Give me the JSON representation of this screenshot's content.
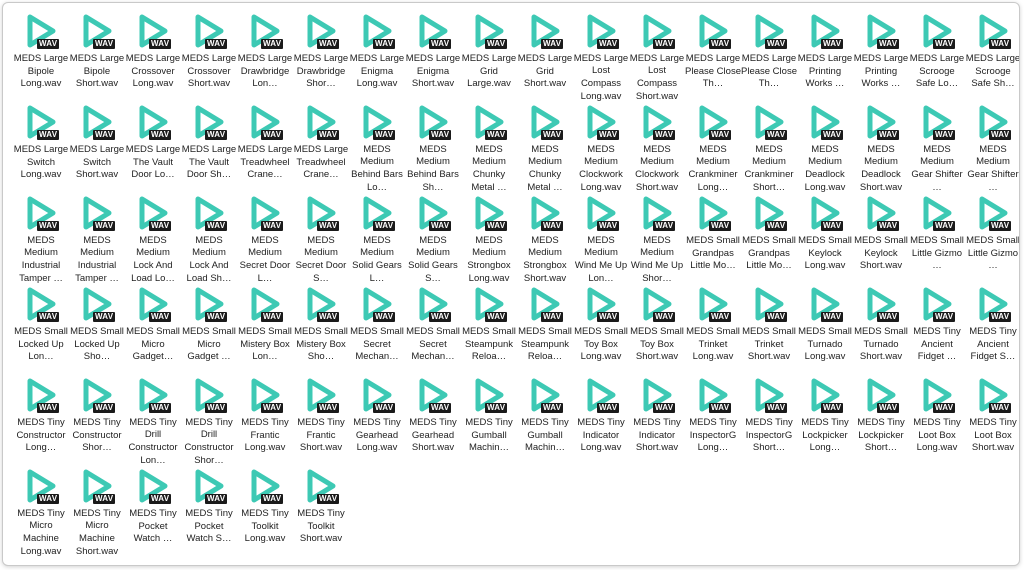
{
  "icon": {
    "name": "wav-audio-file-icon",
    "badge": "WAV",
    "accent": "#3dc9b4"
  },
  "files": [
    {
      "name": "MEDS Large Bipole Long.wav"
    },
    {
      "name": "MEDS Large Bipole Short.wav"
    },
    {
      "name": "MEDS Large Crossover Long.wav"
    },
    {
      "name": "MEDS Large Crossover Short.wav"
    },
    {
      "name": "MEDS Large Drawbridge Lon…"
    },
    {
      "name": "MEDS Large Drawbridge Shor…"
    },
    {
      "name": "MEDS Large Enigma Long.wav"
    },
    {
      "name": "MEDS Large Enigma Short.wav"
    },
    {
      "name": "MEDS Large Grid Large.wav"
    },
    {
      "name": "MEDS Large Grid Short.wav"
    },
    {
      "name": "MEDS Large Lost Compass Long.wav"
    },
    {
      "name": "MEDS Large Lost Compass Short.wav"
    },
    {
      "name": "MEDS Large Please Close Th…"
    },
    {
      "name": "MEDS Large Please Close Th…"
    },
    {
      "name": "MEDS Large Printing Works …"
    },
    {
      "name": "MEDS Large Printing Works …"
    },
    {
      "name": "MEDS Large Scrooge Safe Lo…"
    },
    {
      "name": "MEDS Large Scrooge Safe Sh…"
    },
    {
      "name": "MEDS Large Switch Long.wav"
    },
    {
      "name": "MEDS Large Switch Short.wav"
    },
    {
      "name": "MEDS Large The Vault Door Lo…"
    },
    {
      "name": "MEDS Large The Vault Door Sh…"
    },
    {
      "name": "MEDS Large Treadwheel Crane…"
    },
    {
      "name": "MEDS Large Treadwheel Crane…"
    },
    {
      "name": "MEDS Medium Behind Bars Lo…"
    },
    {
      "name": "MEDS Medium Behind Bars Sh…"
    },
    {
      "name": "MEDS Medium Chunky Metal …"
    },
    {
      "name": "MEDS Medium Chunky Metal …"
    },
    {
      "name": "MEDS Medium Clockwork Long.wav"
    },
    {
      "name": "MEDS Medium Clockwork Short.wav"
    },
    {
      "name": "MEDS Medium Crankminer Long…"
    },
    {
      "name": "MEDS Medium Crankminer Short…"
    },
    {
      "name": "MEDS Medium Deadlock Long.wav"
    },
    {
      "name": "MEDS Medium Deadlock Short.wav"
    },
    {
      "name": "MEDS Medium Gear Shifter …"
    },
    {
      "name": "MEDS Medium Gear Shifter …"
    },
    {
      "name": "MEDS Medium Industrial Tamper …"
    },
    {
      "name": "MEDS Medium Industrial Tamper …"
    },
    {
      "name": "MEDS Medium Lock And Load Lo…"
    },
    {
      "name": "MEDS Medium Lock And Load Sh…"
    },
    {
      "name": "MEDS Medium Secret Door L…"
    },
    {
      "name": "MEDS Medium Secret Door S…"
    },
    {
      "name": "MEDS Medium Solid Gears L…"
    },
    {
      "name": "MEDS Medium Solid Gears S…"
    },
    {
      "name": "MEDS Medium Strongbox Long.wav"
    },
    {
      "name": "MEDS Medium Strongbox Short.wav"
    },
    {
      "name": "MEDS Medium Wind Me Up Lon…"
    },
    {
      "name": "MEDS Medium Wind Me Up Shor…"
    },
    {
      "name": "MEDS Small Grandpas Little Mo…"
    },
    {
      "name": "MEDS Small Grandpas Little Mo…"
    },
    {
      "name": "MEDS Small Keylock Long.wav"
    },
    {
      "name": "MEDS Small Keylock Short.wav"
    },
    {
      "name": "MEDS Small Little Gizmo …"
    },
    {
      "name": "MEDS Small Little Gizmo …"
    },
    {
      "name": "MEDS Small Locked Up Lon…"
    },
    {
      "name": "MEDS Small Locked Up Sho…"
    },
    {
      "name": "MEDS Small Micro Gadget…"
    },
    {
      "name": "MEDS Small Micro Gadget …"
    },
    {
      "name": "MEDS Small Mistery Box Lon…"
    },
    {
      "name": "MEDS Small Mistery Box Sho…"
    },
    {
      "name": "MEDS Small Secret Mechan…"
    },
    {
      "name": "MEDS Small Secret Mechan…"
    },
    {
      "name": "MEDS Small Steampunk Reloa…"
    },
    {
      "name": "MEDS Small Steampunk Reloa…"
    },
    {
      "name": "MEDS Small Toy Box Long.wav"
    },
    {
      "name": "MEDS Small Toy Box Short.wav"
    },
    {
      "name": "MEDS Small Trinket Long.wav"
    },
    {
      "name": "MEDS Small Trinket Short.wav"
    },
    {
      "name": "MEDS Small Turnado Long.wav"
    },
    {
      "name": "MEDS Small Turnado Short.wav"
    },
    {
      "name": "MEDS Tiny Ancient Fidget …"
    },
    {
      "name": "MEDS Tiny Ancient Fidget S…"
    },
    {
      "name": "MEDS Tiny Constructor Long…"
    },
    {
      "name": "MEDS Tiny Constructor Shor…"
    },
    {
      "name": "MEDS Tiny Drill Constructor Lon…"
    },
    {
      "name": "MEDS Tiny Drill Constructor Shor…"
    },
    {
      "name": "MEDS Tiny Frantic Long.wav"
    },
    {
      "name": "MEDS Tiny Frantic Short.wav"
    },
    {
      "name": "MEDS Tiny Gearhead Long.wav"
    },
    {
      "name": "MEDS Tiny Gearhead Short.wav"
    },
    {
      "name": "MEDS Tiny Gumball Machin…"
    },
    {
      "name": "MEDS Tiny Gumball Machin…"
    },
    {
      "name": "MEDS Tiny Indicator Long.wav"
    },
    {
      "name": "MEDS Tiny Indicator Short.wav"
    },
    {
      "name": "MEDS Tiny InspectorG Long…"
    },
    {
      "name": "MEDS Tiny InspectorG Short…"
    },
    {
      "name": "MEDS Tiny Lockpicker Long…"
    },
    {
      "name": "MEDS Tiny Lockpicker Short…"
    },
    {
      "name": "MEDS Tiny Loot Box Long.wav"
    },
    {
      "name": "MEDS Tiny Loot Box Short.wav"
    },
    {
      "name": "MEDS Tiny Micro Machine Long.wav"
    },
    {
      "name": "MEDS Tiny Micro Machine Short.wav"
    },
    {
      "name": "MEDS Tiny Pocket Watch …"
    },
    {
      "name": "MEDS Tiny Pocket Watch S…"
    },
    {
      "name": "MEDS Tiny Toolkit Long.wav"
    },
    {
      "name": "MEDS Tiny Toolkit Short.wav"
    }
  ]
}
